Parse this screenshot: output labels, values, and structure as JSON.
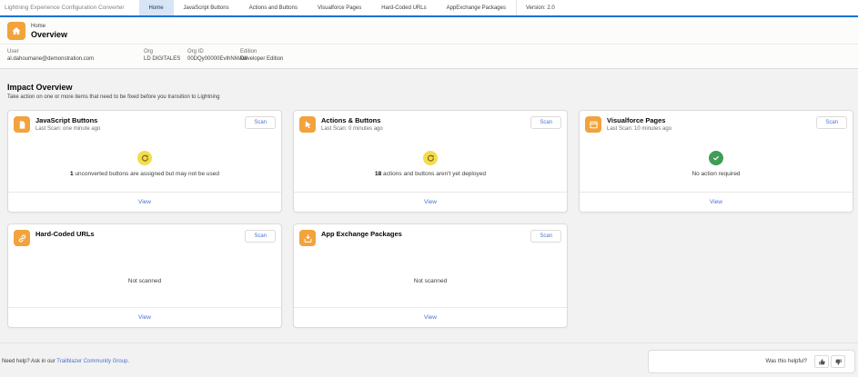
{
  "nav": {
    "app_title": "Lightning Experience Configuration Converter",
    "tabs": [
      {
        "label": "Home",
        "active": true
      },
      {
        "label": "JavaScript Buttons",
        "active": false
      },
      {
        "label": "Actions and Buttons",
        "active": false
      },
      {
        "label": "Visualforce Pages",
        "active": false
      },
      {
        "label": "Hard-Coded URLs",
        "active": false
      },
      {
        "label": "AppExchange Packages",
        "active": false
      }
    ],
    "version": "Version: 2.0"
  },
  "header": {
    "breadcrumb": "Home",
    "title": "Overview",
    "icon": "home-icon",
    "fields": [
      {
        "label": "User",
        "value": "al.dahoumane@demonstration.com"
      },
      {
        "label": "Org",
        "value": "LD DIGITALES"
      },
      {
        "label": "Org ID",
        "value": "00DQy00000EvIhNMAW"
      },
      {
        "label": "Edition",
        "value": "Developer Edition"
      }
    ]
  },
  "section": {
    "title": "Impact Overview",
    "subtitle": "Take action on one or more items that need to be fixed before you transition to Lightning"
  },
  "cards": [
    {
      "title": "JavaScript Buttons",
      "subtitle": "Last Scan: one minute ago",
      "scan_label": "Scan",
      "icon": "document-icon",
      "status": "warning",
      "status_icon": "refresh-icon",
      "count": "1",
      "message": " unconverted buttons are assigned but may not be used",
      "view_label": "View"
    },
    {
      "title": "Actions & Buttons",
      "subtitle": "Last Scan: 0 minutes ago",
      "scan_label": "Scan",
      "icon": "cursor-icon",
      "status": "warning",
      "status_icon": "refresh-icon",
      "count": "18",
      "message": " actions and buttons aren't yet deployed",
      "view_label": "View"
    },
    {
      "title": "Visualforce Pages",
      "subtitle": "Last Scan: 10 minutes ago",
      "scan_label": "Scan",
      "icon": "window-icon",
      "status": "success",
      "status_icon": "check-icon",
      "count": "",
      "message": "No action required",
      "view_label": "View"
    },
    {
      "title": "Hard-Coded URLs",
      "subtitle": "",
      "scan_label": "Scan",
      "icon": "link-icon",
      "status": "not_scanned",
      "status_icon": "",
      "count": "",
      "message": "Not scanned",
      "view_label": "View"
    },
    {
      "title": "App Exchange Packages",
      "subtitle": "",
      "scan_label": "Scan",
      "icon": "package-download-icon",
      "status": "not_scanned",
      "status_icon": "",
      "count": "",
      "message": "Not scanned",
      "view_label": "View"
    }
  ],
  "footer": {
    "help_prefix": "Need help? Ask in our ",
    "help_link": "Trailblazer Community Group.",
    "feedback_label": "Was this helpful?"
  },
  "colors": {
    "nav_underline": "#0176d3",
    "active_tab_bg": "#d8e5f5",
    "tile_orange": "#f2a33c",
    "warning_yellow": "#f5db4d",
    "success_green": "#3f9d58",
    "link_blue": "#4a70d2",
    "page_bg": "#f3f2f2"
  }
}
